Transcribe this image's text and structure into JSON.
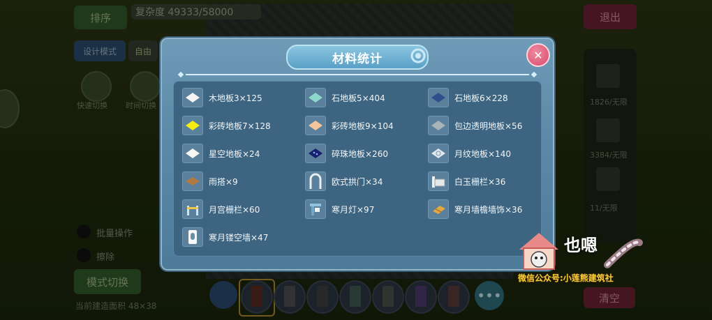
{
  "background": {
    "sort_button": "排序",
    "complexity_label": "复杂度 49333/58000",
    "exit_button": "退出",
    "design_mode_button": "设计模式",
    "free_button": "自由",
    "circle_labels": [
      "快速切换",
      "时间切换"
    ],
    "batch_label": "批量操作",
    "erase_label": "擦除",
    "mode_switch_button": "模式切换",
    "area_label": "当前建造面积 48×38",
    "right_counts": [
      "1826/无限",
      "3384/无限",
      "11/无限"
    ],
    "clear_button": "清空",
    "more_glyph": "•••"
  },
  "modal": {
    "title": "材料统计",
    "close_glyph": "✕",
    "items": [
      {
        "label": "木地板3×125",
        "icon": "white-diamond-tile-icon"
      },
      {
        "label": "石地板5×404",
        "icon": "teal-diamond-tile-icon"
      },
      {
        "label": "石地板6×228",
        "icon": "dark-blue-diamond-tile-icon"
      },
      {
        "label": "彩砖地板7×128",
        "icon": "yellow-diamond-tile-icon"
      },
      {
        "label": "彩砖地板9×104",
        "icon": "peach-diamond-tile-icon"
      },
      {
        "label": "包边透明地板×56",
        "icon": "grey-diamond-tile-icon"
      },
      {
        "label": "星空地板×24",
        "icon": "white-star-tile-icon"
      },
      {
        "label": "碎珠地板×260",
        "icon": "navy-bead-tile-icon"
      },
      {
        "label": "月纹地板×140",
        "icon": "moon-pattern-tile-icon"
      },
      {
        "label": "雨搭×9",
        "icon": "wooden-awning-icon"
      },
      {
        "label": "欧式拱门×34",
        "icon": "arch-door-icon"
      },
      {
        "label": "白玉栅栏×36",
        "icon": "white-jade-fence-icon"
      },
      {
        "label": "月宫栅栏×60",
        "icon": "moon-palace-fence-icon"
      },
      {
        "label": "寒月灯×97",
        "icon": "moon-lamp-icon"
      },
      {
        "label": "寒月墙檐墙饰×36",
        "icon": "eave-decoration-icon"
      },
      {
        "label": "寒月镂空墙×47",
        "icon": "hollow-wall-icon"
      }
    ]
  },
  "watermark": {
    "title": "也嗯",
    "subtitle": "微信公众号:小莲熊建筑社"
  }
}
